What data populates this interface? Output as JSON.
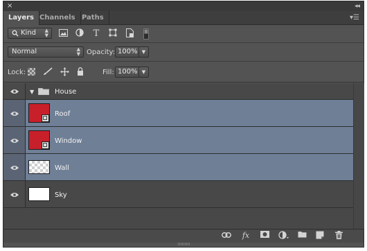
{
  "window": {
    "close_glyph": "×",
    "collapse_glyph": "◂◂",
    "menu_glyph": "▾☰"
  },
  "tabs": [
    {
      "label": "Layers",
      "active": true
    },
    {
      "label": "Channels",
      "active": false
    },
    {
      "label": "Paths",
      "active": false
    }
  ],
  "filter": {
    "kind_label": "Kind",
    "icons": [
      "image-filter-icon",
      "adjustment-filter-icon",
      "type-filter-icon",
      "shape-filter-icon",
      "smart-object-filter-icon",
      "filter-toggle-icon"
    ]
  },
  "blend": {
    "mode": "Normal",
    "opacity_label": "Opacity:",
    "opacity_value": "100%"
  },
  "lock": {
    "label": "Lock:",
    "fill_label": "Fill:",
    "fill_value": "100%"
  },
  "layers": [
    {
      "name": "House",
      "type": "group",
      "selected": false
    },
    {
      "name": "Roof",
      "type": "smart-object",
      "selected": true
    },
    {
      "name": "Window",
      "type": "smart-object",
      "selected": true
    },
    {
      "name": "Wall",
      "type": "transparent",
      "selected": true
    },
    {
      "name": "Sky",
      "type": "white",
      "selected": false
    }
  ],
  "bottom_icons": [
    "link-layers-icon",
    "fx-icon",
    "mask-icon",
    "adjustment-icon",
    "new-group-icon",
    "new-layer-icon",
    "trash-icon"
  ],
  "colors": {
    "panel_bg": "#535353",
    "selection": "#6f7f96",
    "thumb_red": "#c8202b"
  }
}
